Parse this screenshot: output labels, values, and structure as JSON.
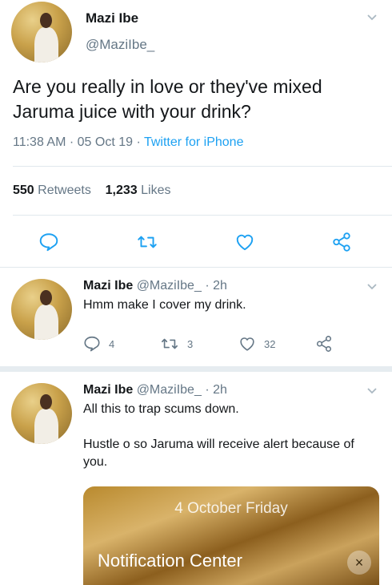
{
  "main_tweet": {
    "name": "Mazi Ibe",
    "handle": "@MaziIbe_",
    "text": "Are you really in love or they've mixed Jaruma juice with your drink?",
    "time": "11:38 AM",
    "separator": "·",
    "date": "05 Oct 19",
    "source": "Twitter for iPhone",
    "retweets_count": "550",
    "retweets_label": "Retweets",
    "likes_count": "1,233",
    "likes_label": "Likes"
  },
  "replies": [
    {
      "name": "Mazi Ibe",
      "handle": "@MaziIbe_",
      "age": "· 2h",
      "text": "Hmm make I cover my drink.",
      "reply_count": "4",
      "retweet_count": "3",
      "like_count": "32"
    },
    {
      "name": "Mazi Ibe",
      "handle": "@MaziIbe_",
      "age": "· 2h",
      "text_line1": "All this to trap scums down.",
      "text_line2": "Hustle o so Jaruma will receive alert because of you.",
      "media": {
        "date_text": "4 October Friday",
        "title": "Notification Center",
        "close": "×"
      }
    }
  ],
  "icons": {
    "reply": "reply-icon",
    "retweet": "retweet-icon",
    "like": "heart-icon",
    "share": "share-icon",
    "menu": "chevron-down-icon"
  },
  "colors": {
    "link": "#1da1f2",
    "muted": "#657786",
    "text": "#14171a"
  }
}
